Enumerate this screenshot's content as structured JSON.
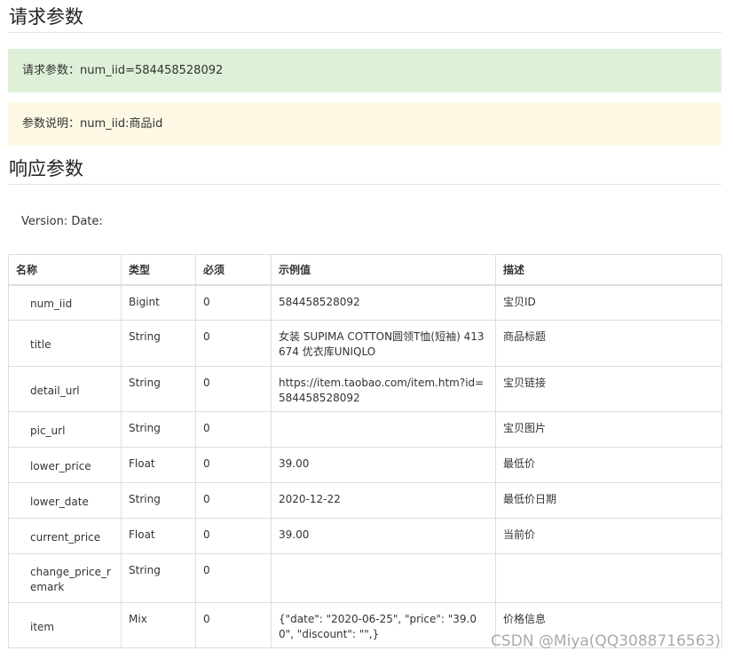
{
  "request": {
    "heading": "请求参数",
    "params_text": "请求参数：num_iid=584458528092",
    "desc_text": "参数说明：num_iid:商品id"
  },
  "response": {
    "heading": "响应参数",
    "version_text": "Version: Date:"
  },
  "table": {
    "headers": [
      "名称",
      "类型",
      "必须",
      "示例值",
      "描述"
    ],
    "rows": [
      {
        "name": "num_iid",
        "type": "Bigint",
        "required": "0",
        "example": "584458528092",
        "desc": "宝贝ID"
      },
      {
        "name": "title",
        "type": "String",
        "required": "0",
        "example": "女装 SUPIMA COTTON圆领T恤(短袖) 413674 优衣库UNIQLO",
        "desc": "商品标题"
      },
      {
        "name": "detail_url",
        "type": "String",
        "required": "0",
        "example": "https://item.taobao.com/item.htm?id=584458528092",
        "desc": "宝贝链接"
      },
      {
        "name": "pic_url",
        "type": "String",
        "required": "0",
        "example": "",
        "desc": "宝贝图片"
      },
      {
        "name": "lower_price",
        "type": "Float",
        "required": "0",
        "example": "39.00",
        "desc": "最低价"
      },
      {
        "name": "lower_date",
        "type": "String",
        "required": "0",
        "example": "2020-12-22",
        "desc": "最低价日期"
      },
      {
        "name": "current_price",
        "type": "Float",
        "required": "0",
        "example": "39.00",
        "desc": "当前价"
      },
      {
        "name": "change_price_remark",
        "type": "String",
        "required": "0",
        "example": "",
        "desc": ""
      },
      {
        "name": "item",
        "type": "Mix",
        "required": "0",
        "example": "{\"date\": \"2020-06-25\", \"price\": \"39.00\", \"discount\": \"\",}",
        "desc": "价格信息"
      }
    ]
  },
  "watermark": "CSDN @Miya(QQ3088716563)"
}
